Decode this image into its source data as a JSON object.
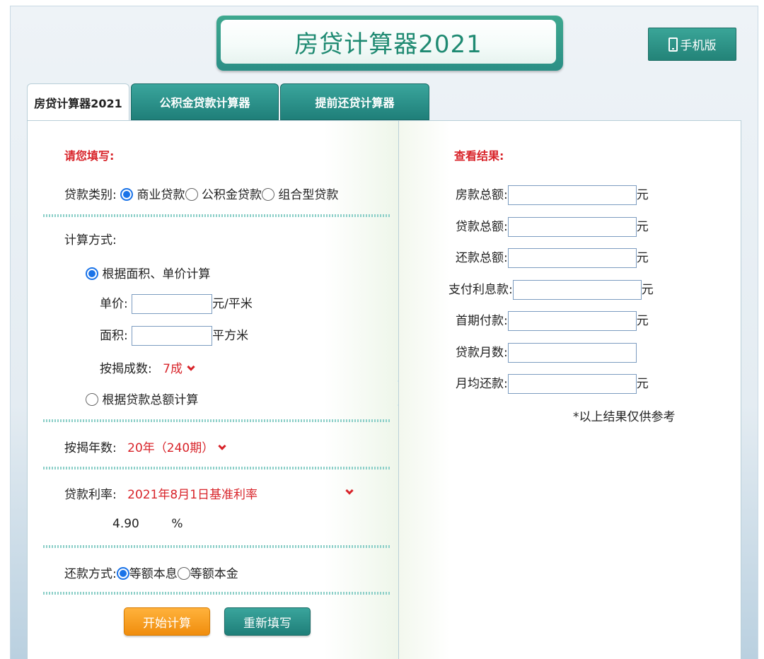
{
  "header": {
    "title": "房贷计算器2021",
    "mobile_label": "手机版"
  },
  "tabs": [
    "房贷计算器2021",
    "公积金贷款计算器",
    "提前还贷计算器"
  ],
  "left": {
    "heading": "请您填写:",
    "loan_type_label": "贷款类别:",
    "loan_types": [
      "商业贷款",
      "公积金贷款",
      "组合型贷款"
    ],
    "calc_method_label": "计算方式:",
    "method_area": "根据面积、单价计算",
    "unit_price_label": "单价:",
    "unit_price_unit": "元/平米",
    "area_label": "面积:",
    "area_unit": "平方米",
    "mortgage_ratio_label": "按揭成数:",
    "mortgage_ratio_value": "7成",
    "method_total": "根据贷款总额计算",
    "years_label": "按揭年数:",
    "years_value": "20年（240期）",
    "rate_label": "贷款利率:",
    "rate_value": "2021年8月1日基准利率",
    "rate_number": "4.90",
    "rate_unit": "%",
    "repay_label": "还款方式:",
    "repay_options": [
      "等额本息",
      "等额本金"
    ],
    "start_button": "开始计算",
    "reset_button": "重新填写"
  },
  "right": {
    "heading": "查看结果:",
    "rows": [
      {
        "label": "房款总额:",
        "unit": "元"
      },
      {
        "label": "贷款总额:",
        "unit": "元"
      },
      {
        "label": "还款总额:",
        "unit": "元"
      },
      {
        "label": "支付利息款:",
        "unit": "元"
      },
      {
        "label": "首期付款:",
        "unit": "元"
      },
      {
        "label": "贷款月数:",
        "unit": ""
      },
      {
        "label": "月均还款:",
        "unit": "元"
      }
    ],
    "note": "*以上结果仅供参考"
  }
}
